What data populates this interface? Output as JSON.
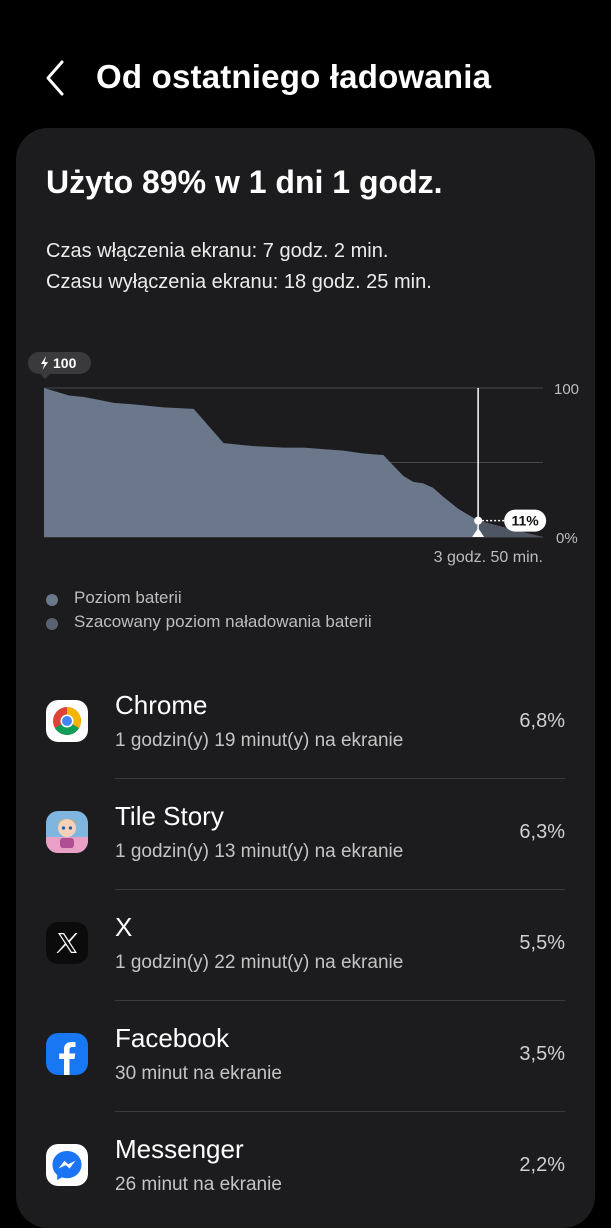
{
  "header": {
    "title": "Od ostatniego ładowania",
    "back_icon": "chevron-left-icon"
  },
  "summary": {
    "title": "Użyto 89% w 1 dni 1 godz.",
    "screen_on": "Czas włączenia ekranu: 7 godz. 2 min.",
    "screen_off": "Czasu wyłączenia ekranu: 18 godz. 25 min."
  },
  "chart_data": {
    "type": "area",
    "ylim": [
      0,
      100
    ],
    "tick_labels": [
      "100",
      "0%"
    ],
    "start_badge": "100",
    "current_label": "11%",
    "remaining_label": "3 godz. 50 min.",
    "series": [
      {
        "name": "Poziom baterii",
        "color": "#6b778a",
        "x": [
          0,
          2,
          5,
          8,
          11,
          14,
          18,
          24,
          30,
          36,
          42,
          48,
          52,
          56,
          60,
          64,
          68,
          70,
          72,
          74,
          76,
          78,
          80,
          83,
          87
        ],
        "values": [
          100,
          98,
          95,
          94,
          92,
          90,
          89,
          87,
          86,
          63,
          61,
          60,
          60,
          59,
          58,
          56,
          55,
          48,
          41,
          37,
          36,
          33,
          27,
          19,
          11
        ]
      },
      {
        "name": "Szacowany poziom naładowania baterii",
        "color": "#4f5663",
        "x": [
          87,
          100
        ],
        "values": [
          11,
          0
        ]
      }
    ],
    "grid": true
  },
  "legend": [
    {
      "label": "Poziom baterii",
      "color": "#6b778a"
    },
    {
      "label": "Szacowany poziom naładowania baterii",
      "color": "#5a6170"
    }
  ],
  "apps": [
    {
      "name": "Chrome",
      "subtitle": "1 godzin(y) 19 minut(y) na ekranie",
      "percent": "6,8%",
      "icon": "chrome-icon"
    },
    {
      "name": "Tile Story",
      "subtitle": "1 godzin(y) 13 minut(y) na ekranie",
      "percent": "6,3%",
      "icon": "tile-story-icon"
    },
    {
      "name": "X",
      "subtitle": "1 godzin(y) 22 minut(y) na ekranie",
      "percent": "5,5%",
      "icon": "x-icon"
    },
    {
      "name": "Facebook",
      "subtitle": "30 minut na ekranie",
      "percent": "3,5%",
      "icon": "facebook-icon"
    },
    {
      "name": "Messenger",
      "subtitle": "26 minut na ekranie",
      "percent": "2,2%",
      "icon": "messenger-icon"
    }
  ]
}
